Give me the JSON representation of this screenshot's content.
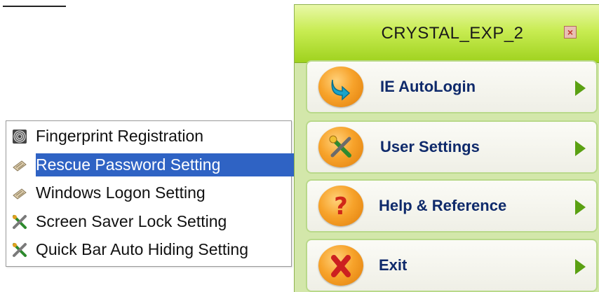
{
  "submenu": {
    "items": [
      {
        "label": "Fingerprint Registration",
        "icon": "fingerprint-icon",
        "selected": false
      },
      {
        "label": "Rescue Password Setting",
        "icon": "keyboard-icon",
        "selected": true
      },
      {
        "label": "Windows Logon Setting",
        "icon": "keyboard-icon",
        "selected": false
      },
      {
        "label": "Screen Saver Lock Setting",
        "icon": "tools-icon",
        "selected": false
      },
      {
        "label": "Quick Bar Auto Hiding Setting",
        "icon": "tools-icon",
        "selected": false
      }
    ],
    "highlight_color": "#2f63c4"
  },
  "panel": {
    "title": "CRYSTAL_EXP_2",
    "close_icon": "close-icon",
    "accent": "#9fd21e",
    "buttons": [
      {
        "label": "IE AutoLogin",
        "icon": "download-arrow-icon"
      },
      {
        "label": "User Settings",
        "icon": "tools-icon"
      },
      {
        "label": "Help & Reference",
        "icon": "question-icon"
      },
      {
        "label": "Exit",
        "icon": "x-icon"
      }
    ]
  }
}
